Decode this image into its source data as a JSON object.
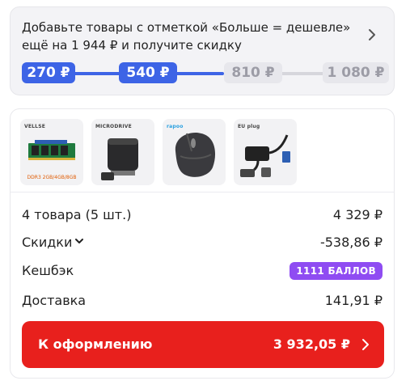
{
  "promo": {
    "text": "Добавьте товары с отметкой «Больше = дешевле» ещё на 1 944 ₽ и получите скидку",
    "tiers": [
      {
        "label": "270 ₽",
        "active": true
      },
      {
        "label": "540 ₽",
        "active": true
      },
      {
        "label": "810 ₽",
        "active": false
      },
      {
        "label": "1 080 ₽",
        "active": false
      }
    ]
  },
  "products": [
    {
      "name": "ram-module",
      "brand_text": "VELLSE",
      "caption": "DDR3 2GB/4GB/8GB"
    },
    {
      "name": "usb-flash-drive",
      "brand_text": "MICRODRIVE"
    },
    {
      "name": "wireless-mouse",
      "brand_text": "rapoo"
    },
    {
      "name": "sata-usb-adapter",
      "brand_text": "EU plug"
    }
  ],
  "summary": {
    "items_label": "4 товара (5 шт.)",
    "items_value": "4 329 ₽",
    "discount_label": "Скидки",
    "discount_value": "-538,86 ₽",
    "cashback_label": "Кешбэк",
    "cashback_value": "1111 БАЛЛОВ",
    "delivery_label": "Доставка",
    "delivery_value": "141,91 ₽"
  },
  "checkout": {
    "label": "К оформлению",
    "total": "3 932,05 ₽"
  },
  "colors": {
    "accent_blue": "#3d64e6",
    "checkout_red": "#e8201d",
    "cashback_purple": "#8f4cf2"
  }
}
